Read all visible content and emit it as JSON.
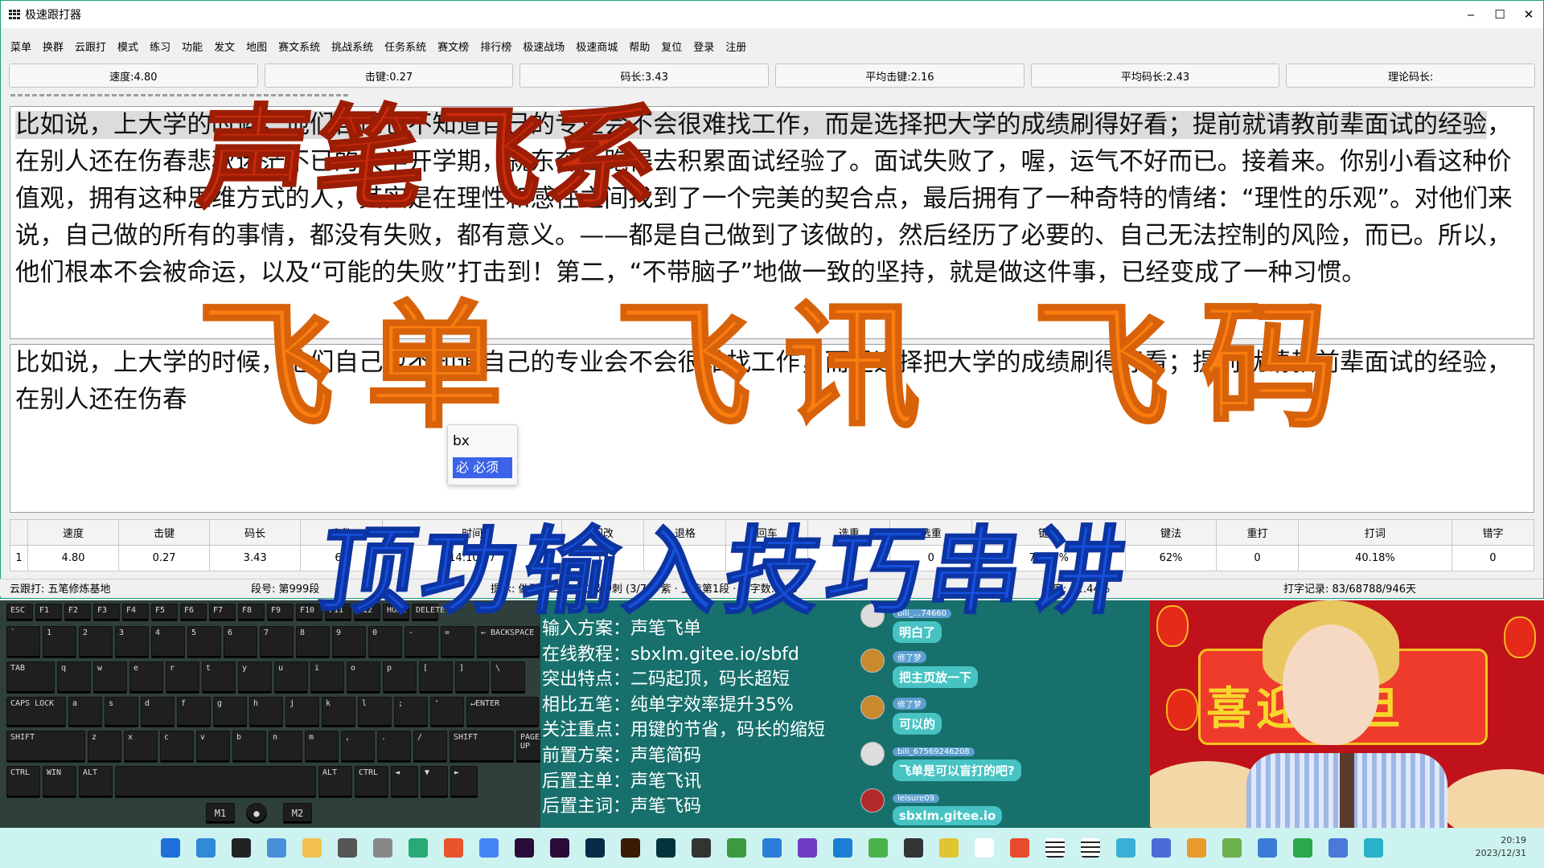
{
  "window": {
    "title": "极速跟打器",
    "controls": [
      "‒",
      "☐",
      "✕"
    ]
  },
  "menu": [
    "菜单",
    "换群",
    "云跟打",
    "模式",
    "练习",
    "功能",
    "发文",
    "地图",
    "赛文系统",
    "挑战系统",
    "任务系统",
    "赛文榜",
    "排行榜",
    "极速战场",
    "极速商城",
    "帮助",
    "复位",
    "登录",
    "注册"
  ],
  "stat_buttons": [
    "速度:4.80",
    "击键:0.27",
    "码长:3.43",
    "平均击键:2.16",
    "平均码长:2.43",
    "理论码长:"
  ],
  "reference_text": {
    "highlight": "比如说，上大学的时候，他们自己也不知道自己的专业会不会很难找工作，而是选择把大学的成绩刷得好看；提前就请教前辈面试的经验",
    "rest": "，在别人还在伤春悲秋迷茫不已的大学开学期，就东奔西跑得去积累面试经验了。面试失败了，喔，运气不好而已。接着来。你别小看这种价值观，拥有这种思维方式的人，其实是在理性和感性之间找到了一个完美的契合点，最后拥有了一种奇特的情绪：“理性的乐观”。对他们来说，自己做的所有的事情，都没有失败，都有意义。——都是自己做到了该做的，然后经历了必要的、自己无法控制的风险，而已。所以，他们根本不会被命运，以及“可能的失败”打击到！第二，“不带脑子”地做一致的坚持，就是做这件事，已经变成了一种习惯。"
  },
  "typed_text": "比如说，上大学的时候，他们自己也不知道自己的专业会不会很难找工作，而是选择把大学的成绩刷得好看；提前就请教前辈面试的经验，在别人还在伤春",
  "ime": {
    "code": "bx",
    "candidate": "必 必须"
  },
  "stats_table": {
    "headers": [
      "",
      "速度",
      "击键",
      "码长",
      "字数",
      "时间",
      "回改",
      "退格",
      "回车",
      "选重",
      "选重",
      "键准",
      "键法",
      "重打",
      "打词",
      "错字"
    ],
    "row": [
      "1",
      "4.80",
      "0.27",
      "3.43",
      "68",
      "14:10.47",
      "15",
      "",
      "",
      "",
      "0",
      "73.39%",
      "62%",
      "0",
      "40.18%",
      "0"
    ]
  },
  "status_bar": {
    "cloud": "云跟打: 五笔修炼基地",
    "segment": "段号: 第999段",
    "tip": "提示: 做到这三点 · 二级冲刺 (3/7) · 紫 · 上传第1段 · 总字数: 303",
    "progress": "进度: 22.44%",
    "record": "打字记录: 83/68788/946天"
  },
  "keyboard": {
    "rows": [
      [
        "ESC",
        "F1",
        "F2",
        "F3",
        "F4",
        "F5",
        "F6",
        "F7",
        "F8",
        "F9",
        "F10",
        "F11",
        "F12",
        "HOME",
        "DELETE"
      ],
      [
        "`",
        "1",
        "2",
        "3",
        "4",
        "5",
        "6",
        "7",
        "8",
        "9",
        "0",
        "-",
        "=",
        "← BACKSPACE"
      ],
      [
        "TAB",
        "q",
        "w",
        "e",
        "r",
        "t",
        "y",
        "u",
        "i",
        "o",
        "p",
        "[",
        "]",
        "\\"
      ],
      [
        "CAPS LOCK",
        "a",
        "s",
        "d",
        "f",
        "g",
        "h",
        "j",
        "k",
        "l",
        ";",
        "'",
        "↵ENTER"
      ],
      [
        "SHIFT",
        "z",
        "x",
        "c",
        "v",
        "b",
        "n",
        "m",
        ",",
        ".",
        "/",
        "SHIFT",
        "PAGE UP",
        "▲",
        "PAGE DN"
      ],
      [
        "CTRL",
        "WIN",
        "ALT",
        "",
        "ALT",
        "CTRL",
        "◄",
        "▼",
        "►"
      ]
    ],
    "mouse": [
      "M1",
      "●",
      "M2"
    ]
  },
  "info_panel": [
    "输入方案：声笔飞单",
    "在线教程：sbxlm.gitee.io/sbfd",
    "突出特点：二码起顶，码长超短",
    "相比五笔：纯单字效率提升35%",
    "关注重点：用键的节省，码长的缩短",
    "前置方案：声笔简码",
    "后置主单：声笔飞讯",
    "后置主词：声笔飞码"
  ],
  "chat": [
    {
      "user": "bili_...74660",
      "text": "明白了"
    },
    {
      "user": "修了梦",
      "text": "把主页放一下"
    },
    {
      "user": "修了梦",
      "text": "可以的"
    },
    {
      "user": "bili_67569246208",
      "text": "飞单是可以盲打的吧?"
    },
    {
      "user": "leisure09",
      "text": "sbxlm.gitee.io"
    }
  ],
  "scene": {
    "banner": "喜迎元旦"
  },
  "taskbar": {
    "time": "20:19",
    "date": "2023/12/31"
  },
  "overlays": {
    "title1": "声笔飞系",
    "title2": "飞单 飞讯 飞码",
    "title3": "顶功输入技巧串讲"
  },
  "colors": {
    "overlay_red": "#cc2b0c",
    "overlay_orange": "#fb7d0f",
    "overlay_blue": "#1650dc",
    "panel_teal": "#17706c",
    "taskbar": "#ccf3ef"
  }
}
